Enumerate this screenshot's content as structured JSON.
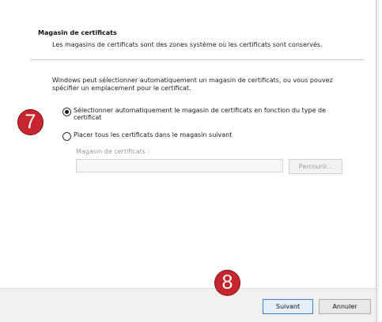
{
  "header": {
    "title": "Magasin de certificats",
    "subtitle": "Les magasins de certificats sont des zones système où les certificats sont conservés."
  },
  "main": {
    "description": "Windows peut sélectionner automatiquement un magasin de certificats, ou vous pouvez spécifier un emplacement pour le certificat.",
    "options": [
      {
        "label": "Sélectionner automatiquement le magasin de certificats en fonction du type de certificat",
        "selected": true
      },
      {
        "label": "Placer tous les certificats dans le magasin suivant",
        "selected": false
      }
    ],
    "store_field": {
      "label": "Magasin de certificats :",
      "value": "",
      "enabled": false
    },
    "browse_label": "Parcourir..."
  },
  "footer": {
    "next_label": "Suivant",
    "cancel_label": "Annuler"
  },
  "annotations": {
    "badge_7": "7",
    "badge_8": "8",
    "badge_color": "#c8262f"
  }
}
